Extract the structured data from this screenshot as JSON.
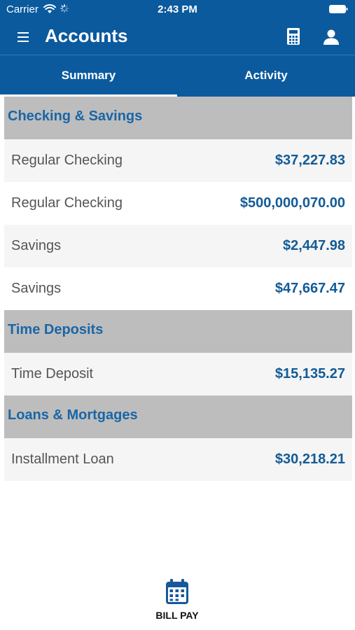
{
  "status_bar": {
    "carrier": "Carrier",
    "time": "2:43 PM"
  },
  "header": {
    "title": "Accounts",
    "menu_icon": "hamburger-menu-icon",
    "calculator_icon": "calculator-icon",
    "profile_icon": "user-icon",
    "background_color": "#0b5a9e"
  },
  "tabs": [
    {
      "label": "Summary",
      "active": true
    },
    {
      "label": "Activity",
      "active": false
    }
  ],
  "sections": [
    {
      "title": "Checking & Savings",
      "accounts": [
        {
          "name": "Regular Checking",
          "balance": "$37,227.83"
        },
        {
          "name": "Regular Checking",
          "balance": "$500,000,070.00"
        },
        {
          "name": "Savings",
          "balance": "$2,447.98"
        },
        {
          "name": "Savings",
          "balance": "$47,667.47"
        }
      ]
    },
    {
      "title": "Time Deposits",
      "accounts": [
        {
          "name": "Time Deposit",
          "balance": "$15,135.27"
        }
      ]
    },
    {
      "title": "Loans & Mortgages",
      "accounts": [
        {
          "name": "Installment Loan",
          "balance": "$30,218.21"
        }
      ]
    }
  ],
  "bottom_action": {
    "label": "BILL PAY",
    "icon": "calendar-icon"
  },
  "colors": {
    "accent": "#1a66a6",
    "section_background": "#bdbdbd",
    "row_alt_background": "#f5f5f5"
  }
}
